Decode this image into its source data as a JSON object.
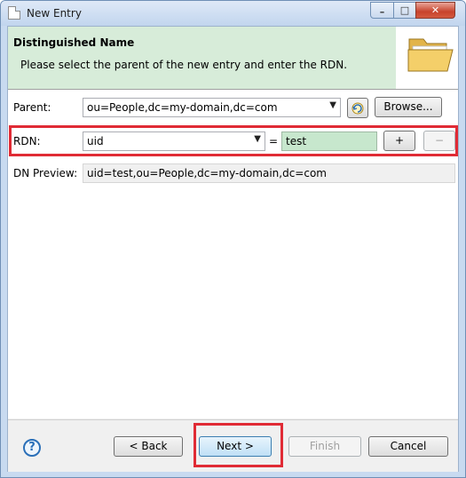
{
  "window": {
    "title": "New Entry",
    "min_glyph": "–",
    "max_glyph": "□",
    "close_glyph": "✕"
  },
  "header": {
    "title": "Distinguished Name",
    "description": "Please select the parent of the new entry and enter the RDN.",
    "icon": "folder-icon"
  },
  "form": {
    "parent_label": "Parent:",
    "parent_value": "ou=People,dc=my-domain,dc=com",
    "browse_label": "Browse...",
    "rdn_label": "RDN:",
    "rdn_attribute": "uid",
    "equals": "=",
    "rdn_value": "test",
    "add_label": "+",
    "remove_label": "−",
    "dn_preview_label": "DN Preview:",
    "dn_preview_value": "uid=test,ou=People,dc=my-domain,dc=com"
  },
  "footer": {
    "help_glyph": "?",
    "back_label": "< Back",
    "next_label": "Next >",
    "finish_label": "Finish",
    "cancel_label": "Cancel"
  },
  "colors": {
    "highlight": "#e02b35",
    "header_bg": "#d7ecd9",
    "rdn_value_bg": "#c7e7cd"
  }
}
